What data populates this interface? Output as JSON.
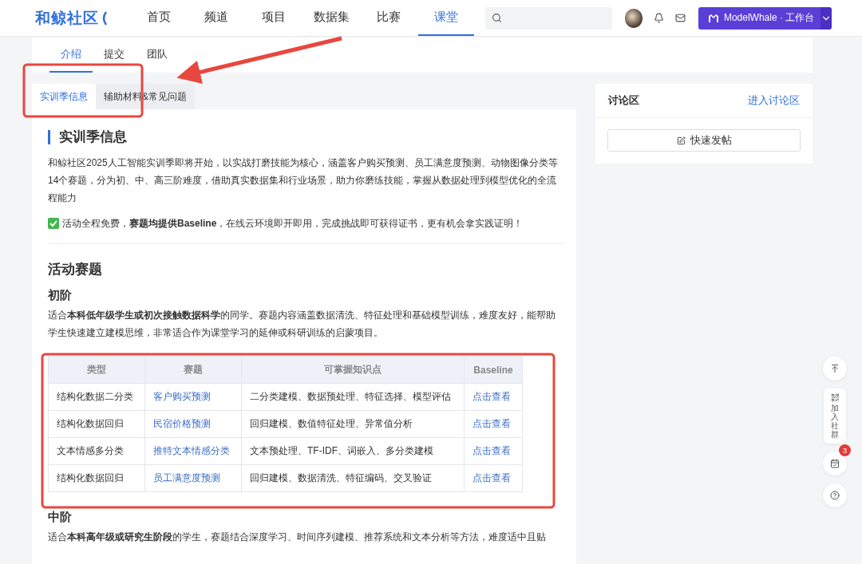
{
  "header": {
    "logo": "和鲸社区",
    "nav": [
      {
        "label": "首页",
        "selected": false
      },
      {
        "label": "频道",
        "selected": false
      },
      {
        "label": "项目",
        "selected": false
      },
      {
        "label": "数据集",
        "selected": false
      },
      {
        "label": "比赛",
        "selected": false
      },
      {
        "label": "课堂",
        "selected": true
      }
    ],
    "workbench": "ModelWhale · 工作台"
  },
  "page_tabs": [
    {
      "label": "介绍",
      "selected": true
    },
    {
      "label": "提交",
      "selected": false
    },
    {
      "label": "团队",
      "selected": false
    }
  ],
  "sub_tabs": [
    {
      "label": "实训季信息",
      "selected": true
    },
    {
      "label": "辅助材料&常见问题",
      "selected": false
    }
  ],
  "article": {
    "title": "实训季信息",
    "intro": "和鲸社区2025人工智能实训季即将开始，以实战打磨技能为核心，涵盖客户购买预测、员工满意度预测、动物图像分类等14个赛题，分为初、中、高三阶难度，借助真实数据集和行业场景，助力你磨练技能，掌握从数据处理到模型优化的全流程能力",
    "notice": "活动全程免费，**赛题均提供Baseline**，在线云环境即开即用，完成挑战即可获得证书，更有机会拿实践证明！",
    "section_title": "活动赛题",
    "levels": [
      {
        "title": "初阶",
        "description": "适合**本科低年级学生或初次接触数据科学**的同学。赛题内容涵盖数据清洗、特征处理和基础模型训练，难度友好，能帮助学生快速建立建模思维，非常适合作为课堂学习的延伸或科研训练的启蒙项目。",
        "table": {
          "columns": [
            "类型",
            "赛题",
            "可掌握知识点",
            "Baseline"
          ],
          "rows": [
            {
              "type": "结构化数据二分类",
              "topic": "客户购买预测",
              "knowledge": "二分类建模、数据预处理、特征选择、模型评估",
              "baseline": "点击查看"
            },
            {
              "type": "结构化数据回归",
              "topic": "民宿价格预测",
              "knowledge": "回归建模、数值特征处理、异常值分析",
              "baseline": "点击查看"
            },
            {
              "type": "文本情感多分类",
              "topic": "推特文本情感分类",
              "knowledge": "文本预处理、TF-IDF、词嵌入、多分类建模",
              "baseline": "点击查看"
            },
            {
              "type": "结构化数据回归",
              "topic": "员工满意度预测",
              "knowledge": "回归建模、数据清洗、特征编码、交叉验证",
              "baseline": "点击查看"
            }
          ]
        }
      },
      {
        "title": "中阶",
        "description": "适合**本科高年级或研究生阶段**的学生，赛题结合深度学习、时间序列建模、推荐系统和文本分析等方法，难度适中且贴"
      }
    ]
  },
  "discussion": {
    "title": "讨论区",
    "link": "进入讨论区",
    "button": "快速发帖"
  },
  "float_bar": [
    {
      "kind": "top"
    },
    {
      "kind": "community",
      "label": "加入社群"
    },
    {
      "kind": "tasks",
      "badge": "3"
    },
    {
      "kind": "help"
    }
  ]
}
